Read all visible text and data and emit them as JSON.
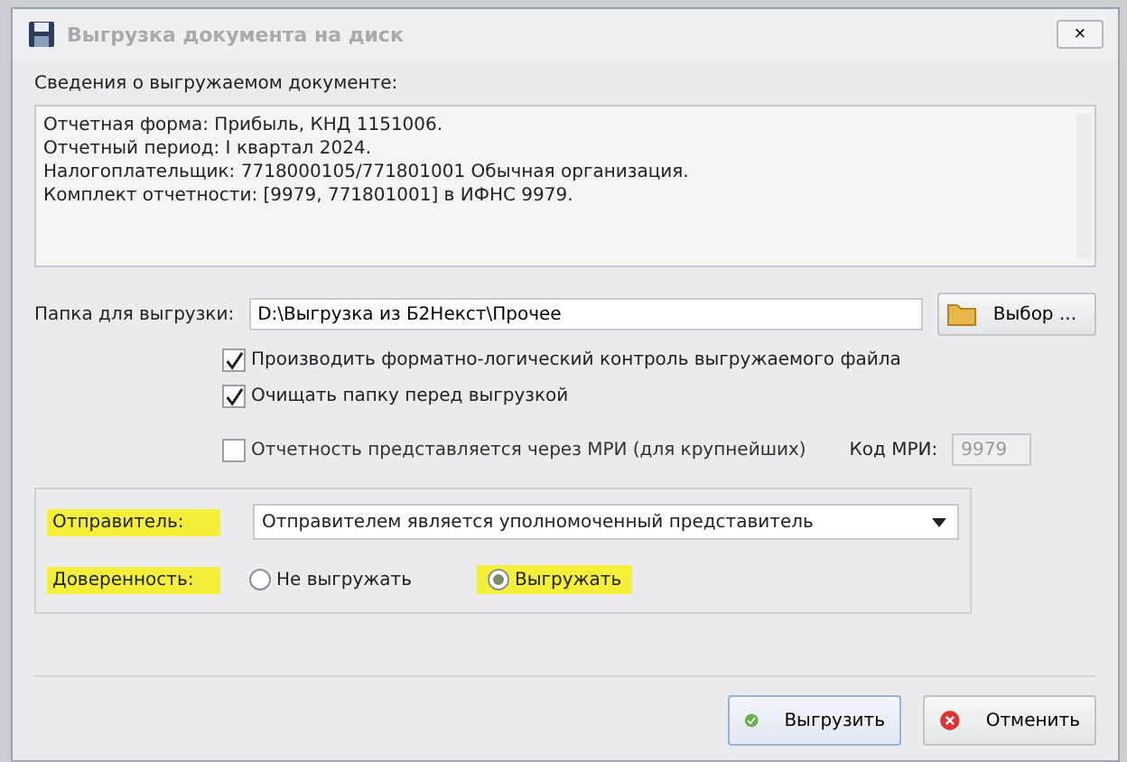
{
  "window": {
    "title": "Выгрузка документа на диск",
    "close": "×"
  },
  "info": {
    "label": "Сведения о выгружаемом документе:",
    "lines": [
      "Отчетная форма: Прибыль, КНД 1151006.",
      "Отчетный период: I квартал 2024.",
      "Налогоплательщик: 7718000105/771801001 Обычная организация.",
      "Комплект отчетности: [9979, 771801001] в ИФНС 9979."
    ]
  },
  "folder": {
    "label": "Папка для выгрузки:",
    "value": "D:\\Выгрузка из Б2Некст\\Прочее",
    "button": "Выбор ..."
  },
  "options": [
    {
      "label": "Производить форматно-логический контроль выгружаемого файла",
      "checked": true
    },
    {
      "label": "Очищать папку перед выгрузкой",
      "checked": true
    }
  ],
  "mri": {
    "label": "Отчетность представляется через МРИ (для крупнейших)",
    "checked": false,
    "code_label": "Код МРИ:",
    "code_value": "9979",
    "disabled": true
  },
  "sender": {
    "label": "Отправитель:",
    "highlighted": true,
    "value": "Отправителем является уполномоченный представитель"
  },
  "proxy": {
    "label": "Доверенность:",
    "highlighted": true,
    "options": [
      {
        "label": "Не выгружать",
        "selected": false,
        "highlighted": false
      },
      {
        "label": "Выгружать",
        "selected": true,
        "highlighted": true
      }
    ]
  },
  "buttons": [
    {
      "label": "Выгрузить",
      "kind": "ok"
    },
    {
      "label": "Отменить",
      "kind": "cancel"
    }
  ]
}
